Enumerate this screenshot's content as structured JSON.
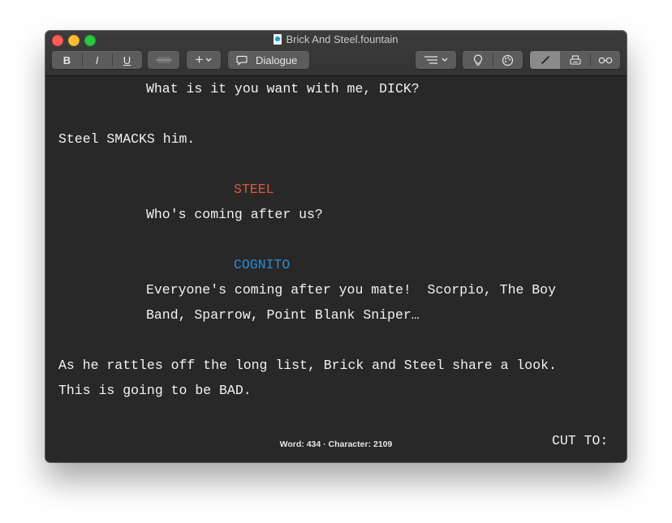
{
  "window": {
    "title": "Brick And Steel.fountain"
  },
  "toolbar": {
    "bold_label": "B",
    "italic_label": "I",
    "underline_label": "U",
    "add_label": "+",
    "element_type_label": "Dialogue"
  },
  "script": {
    "lines": [
      "What is it you want with me, DICK?",
      "Steel SMACKS him.",
      "STEEL",
      "Who's coming after us?",
      "COGNITO",
      "Everyone's coming after you mate!  Scorpio, The Boy",
      "Band, Sparrow, Point Blank Sniper…",
      "As he rattles off the long list, Brick and Steel share a look.",
      "This is going to be BAD.",
      "CUT TO:"
    ]
  },
  "status": {
    "text": "Word: 434 · Character: 2109"
  },
  "colors": {
    "character_steel": "#e2553b",
    "character_cognito": "#2b8ad8"
  }
}
